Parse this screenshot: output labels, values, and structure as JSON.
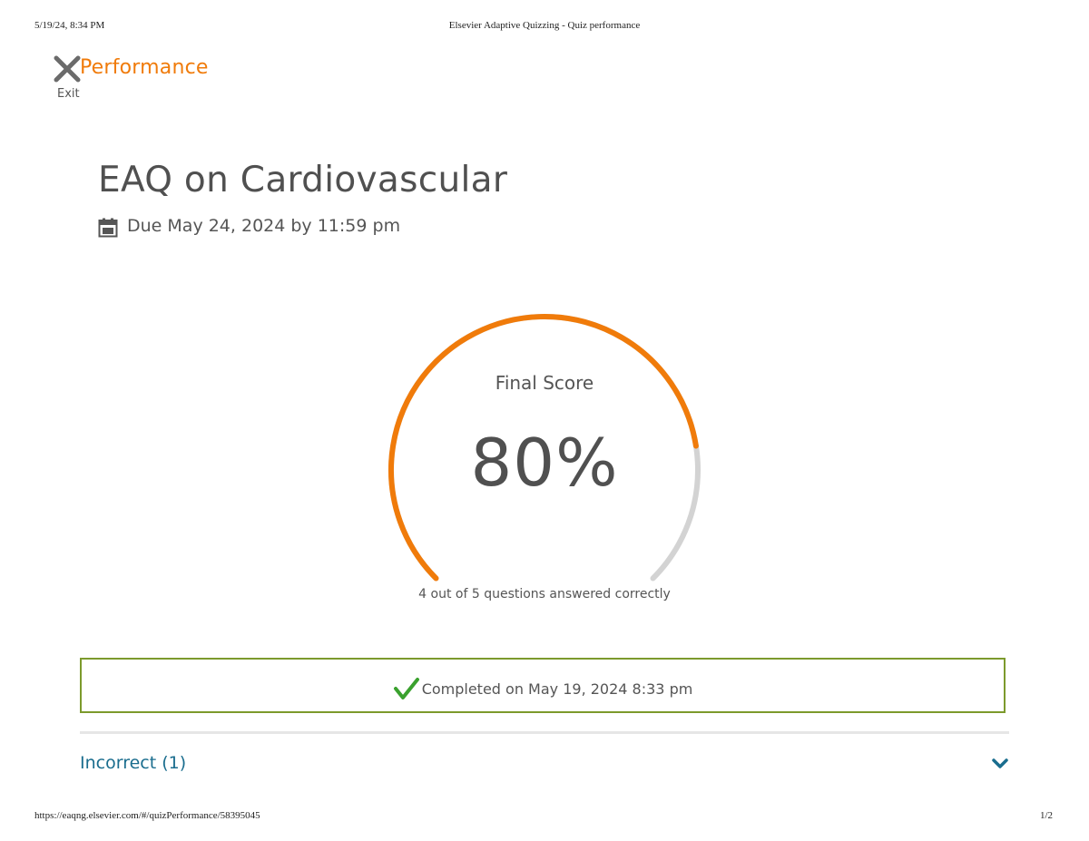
{
  "print": {
    "datetime": "5/19/24, 8:34 PM",
    "doc_title": "Elsevier Adaptive Quizzing - Quiz performance",
    "url": "https://eaqng.elsevier.com/#/quizPerformance/58395045",
    "page": "1/2"
  },
  "header": {
    "exit_label": "Exit",
    "heading": "Performance"
  },
  "quiz": {
    "title": "EAQ on Cardiovascular",
    "due": "Due May 24, 2024 by 11:59 pm"
  },
  "score": {
    "label": "Final Score",
    "value_text": "80%",
    "fraction": 0.8,
    "summary": "4 out of 5 questions answered correctly"
  },
  "completed": {
    "text": "Completed on May 19, 2024 8:33 pm"
  },
  "incorrect": {
    "label": "Incorrect (1)"
  },
  "colors": {
    "accent": "#f07b0a",
    "gauge_track": "#d3d3d3",
    "success_border": "#7c9a2c",
    "check": "#3aa12e",
    "link": "#1a6d8e"
  },
  "icons": {
    "exit": "close-icon",
    "due": "calendar-icon",
    "completed": "checkmark-icon",
    "expand": "chevron-down-icon"
  }
}
